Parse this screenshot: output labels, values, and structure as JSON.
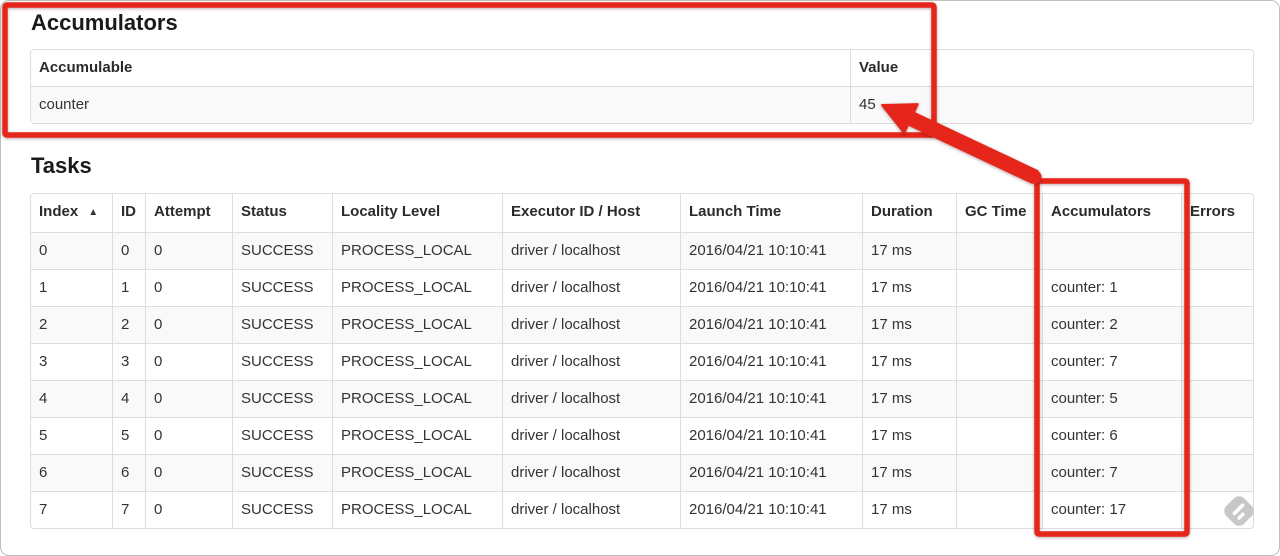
{
  "annotation_color": "#e6261b",
  "accumulators": {
    "title": "Accumulators",
    "columns": [
      "Accumulable",
      "Value"
    ],
    "column_keys": [
      "accumulable",
      "value"
    ],
    "rows": [
      [
        "counter",
        "45"
      ]
    ]
  },
  "tasks": {
    "title": "Tasks",
    "columns": [
      "Index",
      "ID",
      "Attempt",
      "Status",
      "Locality Level",
      "Executor ID / Host",
      "Launch Time",
      "Duration",
      "GC Time",
      "Accumulators",
      "Errors"
    ],
    "column_keys": [
      "index",
      "id",
      "attempt",
      "status",
      "locality-level",
      "executor-id-host",
      "launch-time",
      "duration",
      "gc-time",
      "accumulators",
      "errors"
    ],
    "sorted_column": "Index",
    "sort_indicator": "▲",
    "rows": [
      [
        "0",
        "0",
        "0",
        "SUCCESS",
        "PROCESS_LOCAL",
        "driver / localhost",
        "2016/04/21 10:10:41",
        "17 ms",
        "",
        "",
        ""
      ],
      [
        "1",
        "1",
        "0",
        "SUCCESS",
        "PROCESS_LOCAL",
        "driver / localhost",
        "2016/04/21 10:10:41",
        "17 ms",
        "",
        "counter: 1",
        ""
      ],
      [
        "2",
        "2",
        "0",
        "SUCCESS",
        "PROCESS_LOCAL",
        "driver / localhost",
        "2016/04/21 10:10:41",
        "17 ms",
        "",
        "counter: 2",
        ""
      ],
      [
        "3",
        "3",
        "0",
        "SUCCESS",
        "PROCESS_LOCAL",
        "driver / localhost",
        "2016/04/21 10:10:41",
        "17 ms",
        "",
        "counter: 7",
        ""
      ],
      [
        "4",
        "4",
        "0",
        "SUCCESS",
        "PROCESS_LOCAL",
        "driver / localhost",
        "2016/04/21 10:10:41",
        "17 ms",
        "",
        "counter: 5",
        ""
      ],
      [
        "5",
        "5",
        "0",
        "SUCCESS",
        "PROCESS_LOCAL",
        "driver / localhost",
        "2016/04/21 10:10:41",
        "17 ms",
        "",
        "counter: 6",
        ""
      ],
      [
        "6",
        "6",
        "0",
        "SUCCESS",
        "PROCESS_LOCAL",
        "driver / localhost",
        "2016/04/21 10:10:41",
        "17 ms",
        "",
        "counter: 7",
        ""
      ],
      [
        "7",
        "7",
        "0",
        "SUCCESS",
        "PROCESS_LOCAL",
        "driver / localhost",
        "2016/04/21 10:10:41",
        "17 ms",
        "",
        "counter: 17",
        ""
      ]
    ]
  }
}
